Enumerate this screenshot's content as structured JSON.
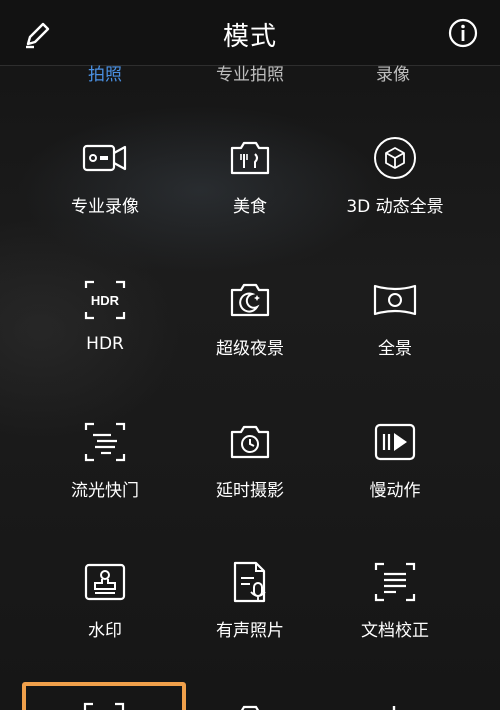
{
  "header": {
    "title": "模式"
  },
  "subtabs": [
    {
      "label": "拍照",
      "active": true
    },
    {
      "label": "专业拍照",
      "active": false
    },
    {
      "label": "录像",
      "active": false
    }
  ],
  "modes": [
    {
      "label": "专业录像",
      "icon": "pro-video-camera-icon"
    },
    {
      "label": "美食",
      "icon": "food-camera-icon"
    },
    {
      "label": "3D 动态全景",
      "icon": "3d-cube-icon"
    },
    {
      "label": "HDR",
      "icon": "hdr-icon"
    },
    {
      "label": "超级夜景",
      "icon": "night-moon-icon"
    },
    {
      "label": "全景",
      "icon": "panorama-icon"
    },
    {
      "label": "流光快门",
      "icon": "light-painting-icon"
    },
    {
      "label": "延时摄影",
      "icon": "time-lapse-icon"
    },
    {
      "label": "慢动作",
      "icon": "slow-motion-icon"
    },
    {
      "label": "水印",
      "icon": "watermark-stamp-icon"
    },
    {
      "label": "有声照片",
      "icon": "audio-photo-icon"
    },
    {
      "label": "文档校正",
      "icon": "document-correction-icon"
    }
  ],
  "colors": {
    "active_tab": "#4a90e2",
    "highlight": "#f0a04b"
  }
}
